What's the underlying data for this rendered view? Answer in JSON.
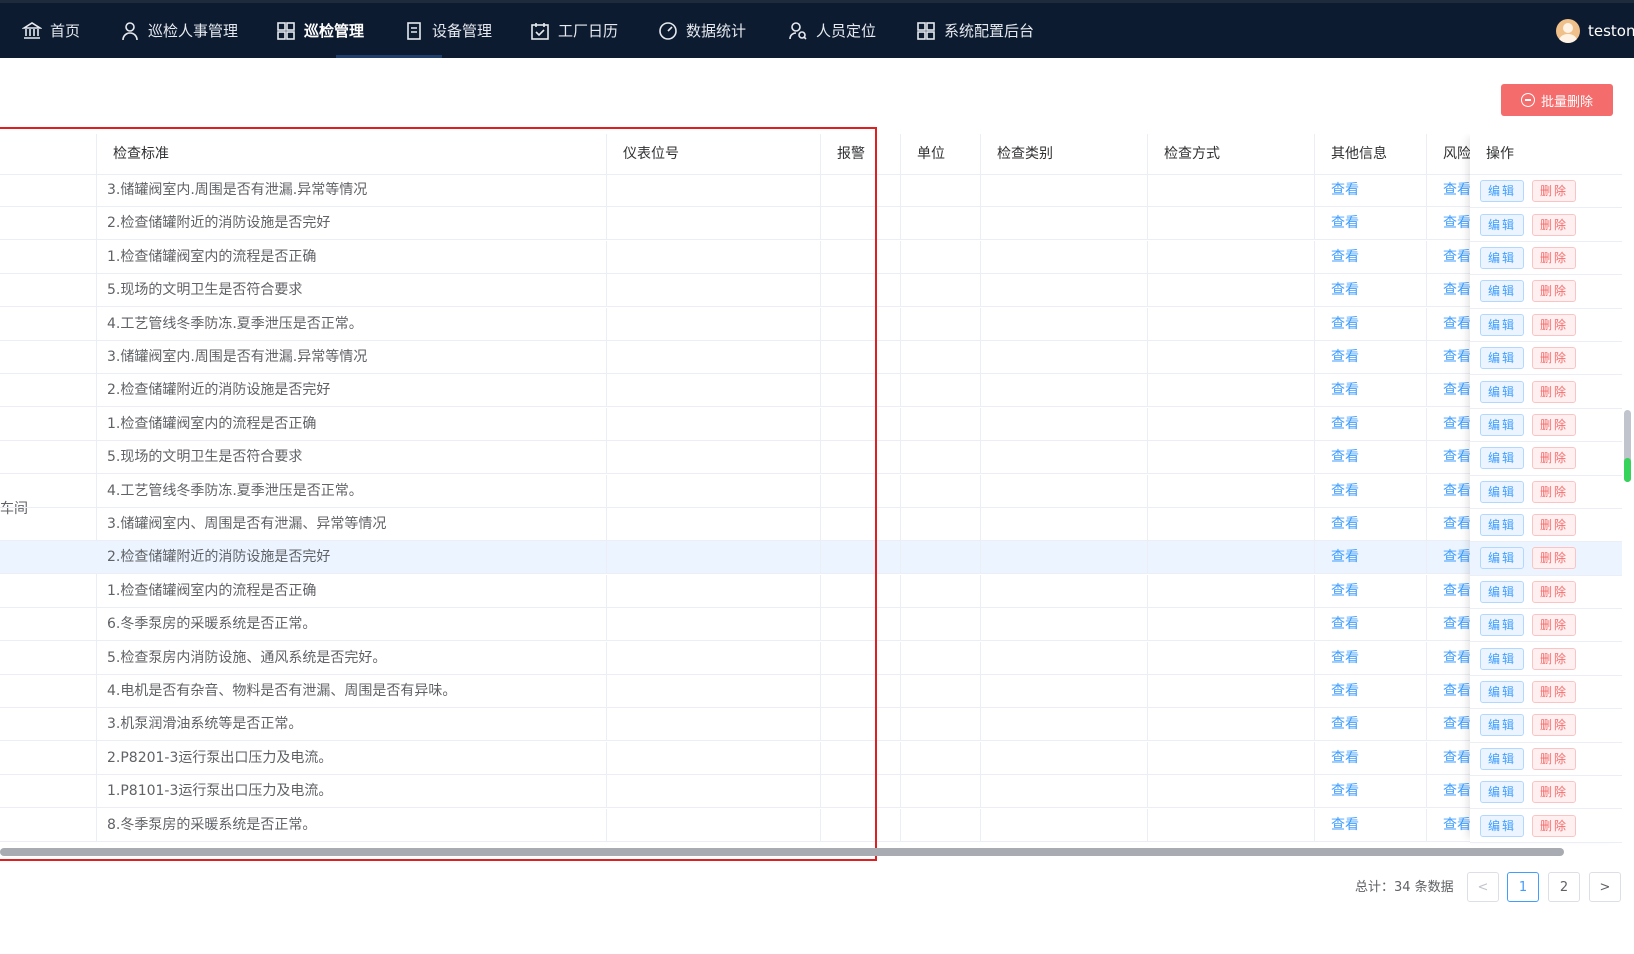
{
  "nav": {
    "items": [
      {
        "label": "首页",
        "icon": "bank-icon"
      },
      {
        "label": "巡检人事管理",
        "icon": "person-icon"
      },
      {
        "label": "巡检管理",
        "icon": "grid-icon",
        "active": true
      },
      {
        "label": "设备管理",
        "icon": "document-icon"
      },
      {
        "label": "工厂日历",
        "icon": "calendar-icon"
      },
      {
        "label": "数据统计",
        "icon": "gauge-icon"
      },
      {
        "label": "人员定位",
        "icon": "person-search-icon"
      },
      {
        "label": "系统配置后台",
        "icon": "apps-icon"
      }
    ],
    "user": "testone"
  },
  "toolbar": {
    "batch_delete": "批量删除"
  },
  "table": {
    "headers": {
      "first": "",
      "standard": "检查标准",
      "meter": "仪表位号",
      "alarm": "报警",
      "unit": "单位",
      "category": "检查类别",
      "method": "检查方式",
      "other": "其他信息",
      "risk": "风险",
      "action": "操作"
    },
    "merged_label": "车间",
    "view_label": "查看",
    "edit_label": "编辑",
    "delete_label": "删除",
    "rows": [
      "3.储罐阀室内.周围是否有泄漏.异常等情况",
      "2.检查储罐附近的消防设施是否完好",
      "1.检查储罐阀室内的流程是否正确",
      "5.现场的文明卫生是否符合要求",
      "4.工艺管线冬季防冻.夏季泄压是否正常。",
      "3.储罐阀室内.周围是否有泄漏.异常等情况",
      "2.检查储罐附近的消防设施是否完好",
      "1.检查储罐阀室内的流程是否正确",
      "5.现场的文明卫生是否符合要求",
      "4.工艺管线冬季防冻.夏季泄压是否正常。",
      "3.储罐阀室内、周围是否有泄漏、异常等情况",
      "2.检查储罐附近的消防设施是否完好",
      "1.检查储罐阀室内的流程是否正确",
      "6.冬季泵房的采暖系统是否正常。",
      "5.检查泵房内消防设施、通风系统是否完好。",
      "4.电机是否有杂音、物料是否有泄漏、周围是否有异味。",
      "3.机泵润滑油系统等是否正常。",
      "2.P8201-3运行泵出口压力及电流。",
      "1.P8101-3运行泵出口压力及电流。",
      "8.冬季泵房的采暖系统是否正常。"
    ],
    "highlight_row": 11
  },
  "pagination": {
    "total": "总计：34 条数据",
    "prev": "<",
    "next": ">",
    "pages": [
      "1",
      "2"
    ],
    "current": "1"
  }
}
